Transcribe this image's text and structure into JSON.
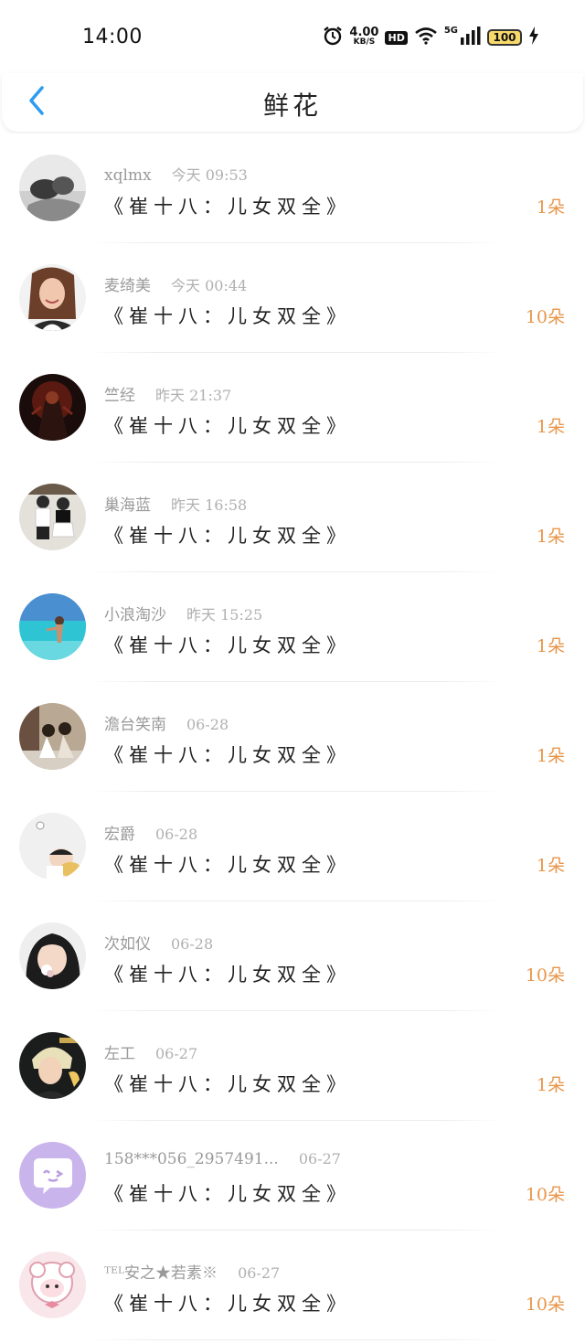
{
  "status": {
    "time": "14:00",
    "speed_value": "4.00",
    "speed_unit": "KB/S",
    "hd": "HD",
    "network": "5G",
    "battery": "100"
  },
  "header": {
    "title": "鲜花"
  },
  "colors": {
    "accent_blue": "#2d9cf0",
    "count_orange": "#e8964a"
  },
  "gifts": [
    {
      "user": "xqlmx",
      "time": "今天 09:53",
      "book": "《崔十八：儿女双全》",
      "count": "1朵",
      "avatar": "bw-couple"
    },
    {
      "user": "麦绮美",
      "time": "今天 00:44",
      "book": "《崔十八：儿女双全》",
      "count": "10朵",
      "avatar": "girl-smile"
    },
    {
      "user": "竺经",
      "time": "昨天 21:37",
      "book": "《崔十八：儿女双全》",
      "count": "1朵",
      "avatar": "dark-art"
    },
    {
      "user": "巢海蓝",
      "time": "昨天 16:58",
      "book": "《崔十八：儿女双全》",
      "count": "1朵",
      "avatar": "couple-white"
    },
    {
      "user": "小浪淘沙",
      "time": "昨天 15:25",
      "book": "《崔十八：儿女双全》",
      "count": "1朵",
      "avatar": "beach"
    },
    {
      "user": "澹台笑南",
      "time": "06-28",
      "book": "《崔十八：儿女双全》",
      "count": "1朵",
      "avatar": "couple-sitting"
    },
    {
      "user": "宏爵",
      "time": "06-28",
      "book": "《崔十八：儿女双全》",
      "count": "1朵",
      "avatar": "baby-white"
    },
    {
      "user": "次如仪",
      "time": "06-28",
      "book": "《崔十八：儿女双全》",
      "count": "10朵",
      "avatar": "girl-dark-hair"
    },
    {
      "user": "左工",
      "time": "06-27",
      "book": "《崔十八：儿女双全》",
      "count": "1朵",
      "avatar": "boy-portrait"
    },
    {
      "user": "158***056_2957491...",
      "time": "06-27",
      "book": "《崔十八：儿女双全》",
      "count": "10朵",
      "avatar": "purple-chat"
    },
    {
      "user": "ᵀᴱᴸ安之★若素※",
      "time": "06-27",
      "book": "《崔十八：儿女双全》",
      "count": "10朵",
      "avatar": "pink-sheep"
    }
  ]
}
